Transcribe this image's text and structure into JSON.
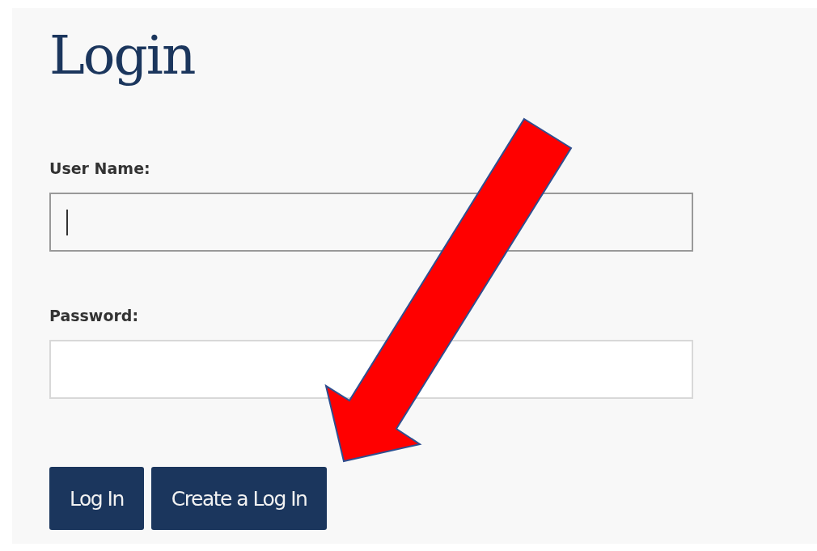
{
  "title": "Login",
  "fields": [
    {
      "label": "User Name:",
      "focused": true
    },
    {
      "label": "Password:",
      "focused": false
    }
  ],
  "buttons": [
    {
      "label": "Log In"
    },
    {
      "label": "Create a Log In"
    }
  ]
}
